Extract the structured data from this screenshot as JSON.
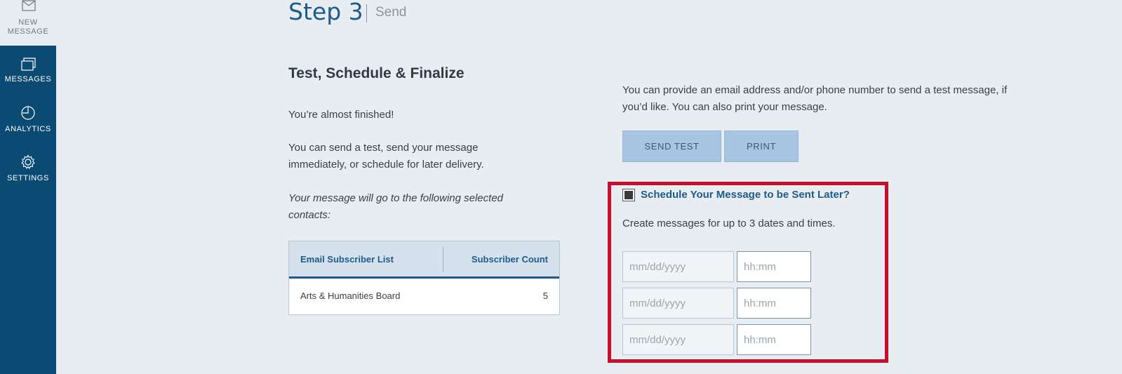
{
  "sidebar": {
    "new_message": "NEW\nMESSAGE",
    "new_message_line1": "NEW",
    "new_message_line2": "MESSAGE",
    "items": [
      {
        "label": "MESSAGES",
        "icon": "messages-icon"
      },
      {
        "label": "ANALYTICS",
        "icon": "pie-chart-icon"
      },
      {
        "label": "SETTINGS",
        "icon": "gear-icon"
      }
    ]
  },
  "header": {
    "step": "Step 3",
    "sub": "Send"
  },
  "left": {
    "title": "Test, Schedule & Finalize",
    "p1": "You’re almost finished!",
    "p2_line1": "You can send a test, send your message",
    "p2_line2": "immediately, or schedule for later delivery.",
    "p3_line1": "Your message will go to the following selected",
    "p3_line2": "contacts:",
    "table": {
      "headers": [
        "Email Subscriber List",
        "Subscriber Count"
      ],
      "rows": [
        {
          "list": "Arts & Humanities Board",
          "count": "5"
        }
      ]
    }
  },
  "right": {
    "intro_line1": "You can provide an email address and/or phone number to send a test message, if",
    "intro_line2": "you’d like. You can also print your message.",
    "send_test": "SEND TEST",
    "print": "PRINT",
    "schedule_label": "Schedule Your Message to be Sent Later?",
    "schedule_desc": "Create messages for up to 3 dates and times.",
    "date_placeholder": "mm/dd/yyyy",
    "time_placeholder": "hh:mm"
  },
  "colors": {
    "accent": "#1d5b8c",
    "sidebar": "#0b4a73",
    "highlight": "#c4102c",
    "button": "#a7c5e3"
  }
}
